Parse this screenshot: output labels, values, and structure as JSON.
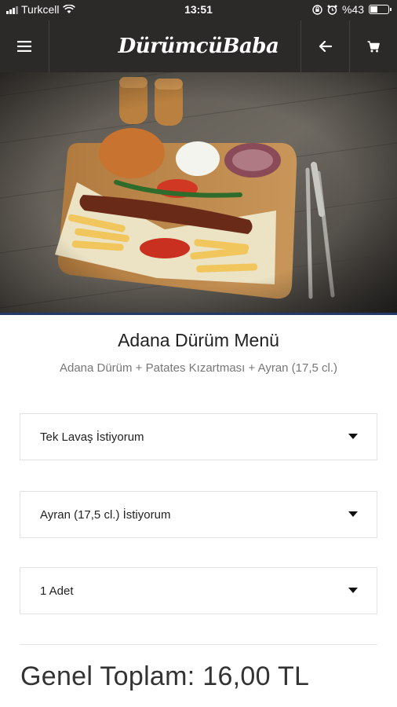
{
  "status_bar": {
    "carrier": "Turkcell",
    "time": "13:51",
    "battery": "%43",
    "battery_level": 0.43
  },
  "header": {
    "logo_text": "DürümcüBaba",
    "menu_icon": "hamburger-icon",
    "back_icon": "arrow-left-icon",
    "cart_icon": "cart-icon"
  },
  "product": {
    "title": "Adana Dürüm Menü",
    "description": "Adana Dürüm + Patates Kızartması + Ayran (17,5 cl.)"
  },
  "options": {
    "bread": "Tek Lavaş İstiyorum",
    "drink": "Ayran (17,5 cl.) İstiyorum",
    "quantity": "1 Adet"
  },
  "total": {
    "text": "Genel Toplam: 16,00 TL"
  },
  "colors": {
    "header_bg": "#2b2a29",
    "accent_line": "#243a66"
  }
}
